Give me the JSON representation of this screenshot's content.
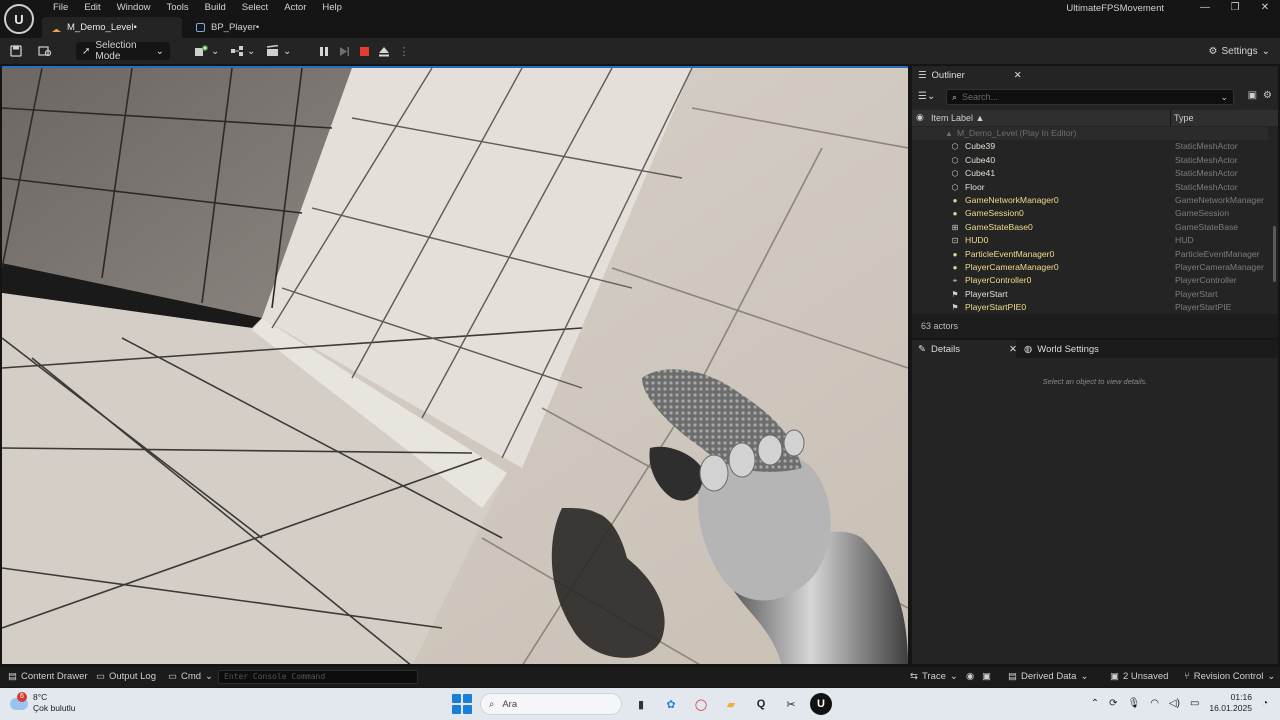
{
  "menu": {
    "items": [
      "File",
      "Edit",
      "Window",
      "Tools",
      "Build",
      "Select",
      "Actor",
      "Help"
    ]
  },
  "window": {
    "title": "UltimateFPSMovement",
    "minimize": "—",
    "maximize": "❐",
    "close": "✕"
  },
  "tabs": [
    {
      "label": "M_Demo_Level•",
      "active": true
    },
    {
      "label": "BP_Player•",
      "active": false
    }
  ],
  "toolbar": {
    "selection_mode": "Selection Mode",
    "settings_label": "Settings"
  },
  "outliner": {
    "title": "Outliner",
    "search_placeholder": "Search...",
    "col_label": "Item Label ▲",
    "col_type": "Type",
    "level_row": "M_Demo_Level (Play In Editor)",
    "rows": [
      {
        "label": "Cube39",
        "type": "StaticMeshActor",
        "icon": "cube-icon",
        "kind": "actor"
      },
      {
        "label": "Cube40",
        "type": "StaticMeshActor",
        "icon": "cube-icon",
        "kind": "actor"
      },
      {
        "label": "Cube41",
        "type": "StaticMeshActor",
        "icon": "cube-icon",
        "kind": "actor"
      },
      {
        "label": "Floor",
        "type": "StaticMeshActor",
        "icon": "cube-icon",
        "kind": "actor"
      },
      {
        "label": "GameNetworkManager0",
        "type": "GameNetworkManager",
        "icon": "actor-icon",
        "kind": "spawn"
      },
      {
        "label": "GameSession0",
        "type": "GameSession",
        "icon": "actor-icon",
        "kind": "spawn"
      },
      {
        "label": "GameStateBase0",
        "type": "GameStateBase",
        "icon": "state-icon",
        "kind": "spawn"
      },
      {
        "label": "HUD0",
        "type": "HUD",
        "icon": "hud-icon",
        "kind": "spawn"
      },
      {
        "label": "ParticleEventManager0",
        "type": "ParticleEventManager",
        "icon": "actor-icon",
        "kind": "spawn"
      },
      {
        "label": "PlayerCameraManager0",
        "type": "PlayerCameraManager",
        "icon": "actor-icon",
        "kind": "spawn"
      },
      {
        "label": "PlayerController0",
        "type": "PlayerController",
        "icon": "controller-icon",
        "kind": "spawn"
      },
      {
        "label": "PlayerStart",
        "type": "PlayerStart",
        "icon": "flag-icon",
        "kind": "actor"
      },
      {
        "label": "PlayerStartPIE0",
        "type": "PlayerStartPIE",
        "icon": "flag-icon",
        "kind": "spawn"
      }
    ],
    "actor_count": "63 actors"
  },
  "details": {
    "title": "Details",
    "world_settings": "World Settings",
    "empty_message": "Select an object to view details."
  },
  "statusbar": {
    "content_drawer": "Content Drawer",
    "output_log": "Output Log",
    "cmd": "Cmd",
    "console_placeholder": "Enter Console Command",
    "trace": "Trace",
    "derived_data": "Derived Data",
    "unsaved": "2 Unsaved",
    "revision_control": "Revision Control"
  },
  "taskbar": {
    "weather_temp": "8°C",
    "weather_desc": "Çok bulutlu",
    "weather_badge": "6",
    "search": "Ara",
    "time": "01:16",
    "date": "16.01.2025"
  },
  "colors": {
    "accent": "#2a6dbf",
    "spawned_actor": "#f0dc8c",
    "taskbar": "#e3e7ee"
  }
}
